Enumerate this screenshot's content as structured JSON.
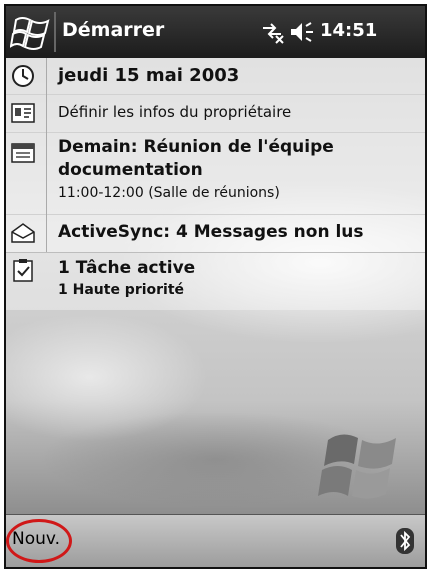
{
  "titlebar": {
    "title": "Démarrer",
    "clock": "14:51"
  },
  "today": {
    "date": "jeudi 15 mai 2003",
    "owner": "Définir les infos du propriétaire",
    "appointment_line1": "Demain: Réunion de l'équipe",
    "appointment_line2": "documentation",
    "appointment_time": "11:00-12:00 (Salle de réunions)",
    "activesync": "ActiveSync: 4 Messages non lus",
    "tasks_line1": "1 Tâche active",
    "tasks_line2": "1 Haute priorité"
  },
  "menubar": {
    "new_label": "Nouv."
  },
  "colors": {
    "titlebar": "#1c1c1c",
    "highlight_ring": "#d01818"
  }
}
